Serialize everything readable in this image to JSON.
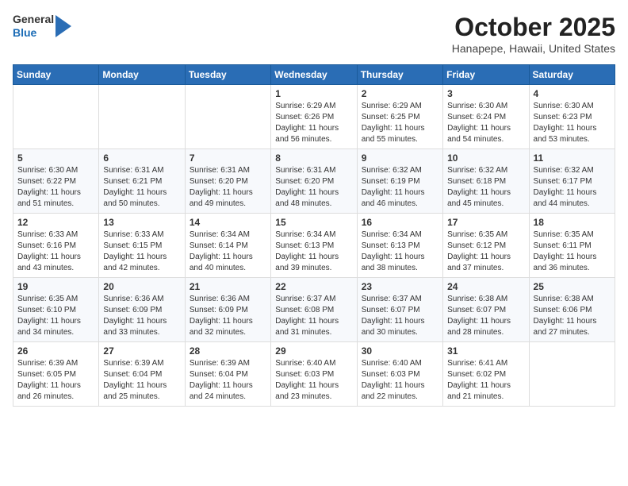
{
  "header": {
    "logo": {
      "general": "General",
      "blue": "Blue"
    },
    "title": "October 2025",
    "subtitle": "Hanapepe, Hawaii, United States"
  },
  "weekdays": [
    "Sunday",
    "Monday",
    "Tuesday",
    "Wednesday",
    "Thursday",
    "Friday",
    "Saturday"
  ],
  "weeks": [
    [
      {
        "day": "",
        "info": ""
      },
      {
        "day": "",
        "info": ""
      },
      {
        "day": "",
        "info": ""
      },
      {
        "day": "1",
        "info": "Sunrise: 6:29 AM\nSunset: 6:26 PM\nDaylight: 11 hours\nand 56 minutes."
      },
      {
        "day": "2",
        "info": "Sunrise: 6:29 AM\nSunset: 6:25 PM\nDaylight: 11 hours\nand 55 minutes."
      },
      {
        "day": "3",
        "info": "Sunrise: 6:30 AM\nSunset: 6:24 PM\nDaylight: 11 hours\nand 54 minutes."
      },
      {
        "day": "4",
        "info": "Sunrise: 6:30 AM\nSunset: 6:23 PM\nDaylight: 11 hours\nand 53 minutes."
      }
    ],
    [
      {
        "day": "5",
        "info": "Sunrise: 6:30 AM\nSunset: 6:22 PM\nDaylight: 11 hours\nand 51 minutes."
      },
      {
        "day": "6",
        "info": "Sunrise: 6:31 AM\nSunset: 6:21 PM\nDaylight: 11 hours\nand 50 minutes."
      },
      {
        "day": "7",
        "info": "Sunrise: 6:31 AM\nSunset: 6:20 PM\nDaylight: 11 hours\nand 49 minutes."
      },
      {
        "day": "8",
        "info": "Sunrise: 6:31 AM\nSunset: 6:20 PM\nDaylight: 11 hours\nand 48 minutes."
      },
      {
        "day": "9",
        "info": "Sunrise: 6:32 AM\nSunset: 6:19 PM\nDaylight: 11 hours\nand 46 minutes."
      },
      {
        "day": "10",
        "info": "Sunrise: 6:32 AM\nSunset: 6:18 PM\nDaylight: 11 hours\nand 45 minutes."
      },
      {
        "day": "11",
        "info": "Sunrise: 6:32 AM\nSunset: 6:17 PM\nDaylight: 11 hours\nand 44 minutes."
      }
    ],
    [
      {
        "day": "12",
        "info": "Sunrise: 6:33 AM\nSunset: 6:16 PM\nDaylight: 11 hours\nand 43 minutes."
      },
      {
        "day": "13",
        "info": "Sunrise: 6:33 AM\nSunset: 6:15 PM\nDaylight: 11 hours\nand 42 minutes."
      },
      {
        "day": "14",
        "info": "Sunrise: 6:34 AM\nSunset: 6:14 PM\nDaylight: 11 hours\nand 40 minutes."
      },
      {
        "day": "15",
        "info": "Sunrise: 6:34 AM\nSunset: 6:13 PM\nDaylight: 11 hours\nand 39 minutes."
      },
      {
        "day": "16",
        "info": "Sunrise: 6:34 AM\nSunset: 6:13 PM\nDaylight: 11 hours\nand 38 minutes."
      },
      {
        "day": "17",
        "info": "Sunrise: 6:35 AM\nSunset: 6:12 PM\nDaylight: 11 hours\nand 37 minutes."
      },
      {
        "day": "18",
        "info": "Sunrise: 6:35 AM\nSunset: 6:11 PM\nDaylight: 11 hours\nand 36 minutes."
      }
    ],
    [
      {
        "day": "19",
        "info": "Sunrise: 6:35 AM\nSunset: 6:10 PM\nDaylight: 11 hours\nand 34 minutes."
      },
      {
        "day": "20",
        "info": "Sunrise: 6:36 AM\nSunset: 6:09 PM\nDaylight: 11 hours\nand 33 minutes."
      },
      {
        "day": "21",
        "info": "Sunrise: 6:36 AM\nSunset: 6:09 PM\nDaylight: 11 hours\nand 32 minutes."
      },
      {
        "day": "22",
        "info": "Sunrise: 6:37 AM\nSunset: 6:08 PM\nDaylight: 11 hours\nand 31 minutes."
      },
      {
        "day": "23",
        "info": "Sunrise: 6:37 AM\nSunset: 6:07 PM\nDaylight: 11 hours\nand 30 minutes."
      },
      {
        "day": "24",
        "info": "Sunrise: 6:38 AM\nSunset: 6:07 PM\nDaylight: 11 hours\nand 28 minutes."
      },
      {
        "day": "25",
        "info": "Sunrise: 6:38 AM\nSunset: 6:06 PM\nDaylight: 11 hours\nand 27 minutes."
      }
    ],
    [
      {
        "day": "26",
        "info": "Sunrise: 6:39 AM\nSunset: 6:05 PM\nDaylight: 11 hours\nand 26 minutes."
      },
      {
        "day": "27",
        "info": "Sunrise: 6:39 AM\nSunset: 6:04 PM\nDaylight: 11 hours\nand 25 minutes."
      },
      {
        "day": "28",
        "info": "Sunrise: 6:39 AM\nSunset: 6:04 PM\nDaylight: 11 hours\nand 24 minutes."
      },
      {
        "day": "29",
        "info": "Sunrise: 6:40 AM\nSunset: 6:03 PM\nDaylight: 11 hours\nand 23 minutes."
      },
      {
        "day": "30",
        "info": "Sunrise: 6:40 AM\nSunset: 6:03 PM\nDaylight: 11 hours\nand 22 minutes."
      },
      {
        "day": "31",
        "info": "Sunrise: 6:41 AM\nSunset: 6:02 PM\nDaylight: 11 hours\nand 21 minutes."
      },
      {
        "day": "",
        "info": ""
      }
    ]
  ]
}
